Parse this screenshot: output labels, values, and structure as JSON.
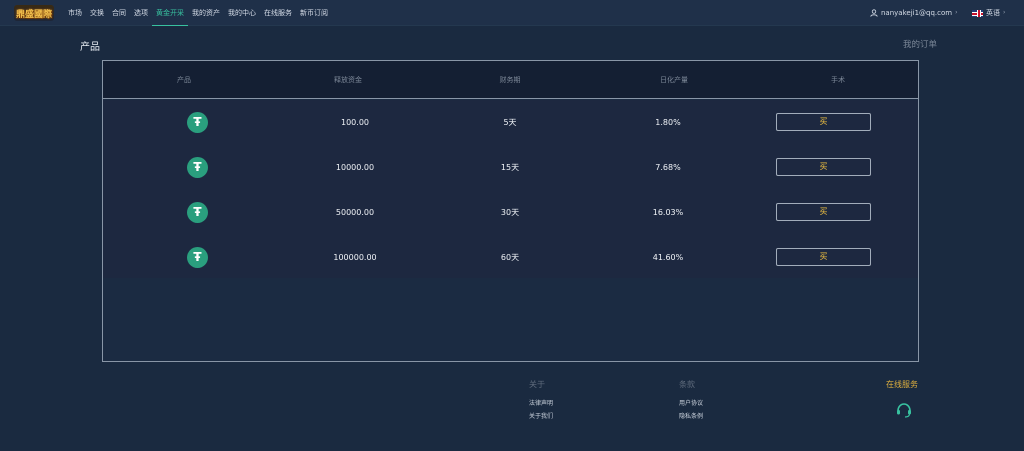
{
  "header": {
    "logo_text": "鼎盛國際",
    "nav": [
      "市场",
      "交换",
      "合同",
      "选项",
      "黄金开采",
      "我的资产",
      "我的中心",
      "在线服务",
      "新币订阅"
    ],
    "active_index": 4,
    "user_email": "nanyakeji1@qq.com",
    "language": "英语",
    "colors": {
      "accent": "#38c2a0",
      "gold": "#f0c040"
    }
  },
  "page": {
    "title": "产品",
    "my_orders": "我的订单"
  },
  "table": {
    "headers": [
      "产品",
      "释放资金",
      "财务期",
      "日化产量",
      "手术"
    ],
    "rows": [
      {
        "icon": "tether-usdt-icon",
        "amount": "100.00",
        "term": "5天",
        "daily_yield": "1.80%",
        "action": "买"
      },
      {
        "icon": "tether-usdt-icon",
        "amount": "10000.00",
        "term": "15天",
        "daily_yield": "7.68%",
        "action": "买"
      },
      {
        "icon": "tether-usdt-icon",
        "amount": "50000.00",
        "term": "30天",
        "daily_yield": "16.03%",
        "action": "买"
      },
      {
        "icon": "tether-usdt-icon",
        "amount": "100000.00",
        "term": "60天",
        "daily_yield": "41.60%",
        "action": "买"
      }
    ]
  },
  "footer": {
    "about": {
      "title": "关于",
      "links": [
        "法律声明",
        "关于我们"
      ]
    },
    "terms": {
      "title": "条款",
      "links": [
        "用户协议",
        "隐私条例"
      ]
    },
    "service": {
      "title": "在线服务",
      "icon": "headset-icon"
    }
  }
}
